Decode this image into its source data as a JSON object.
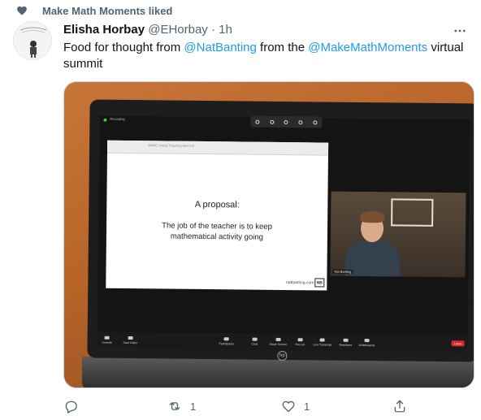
{
  "social_context": {
    "text": "Make Math Moments liked"
  },
  "tweet": {
    "display_name": "Elisha Horbay",
    "handle": "@EHorbay",
    "separator": "·",
    "time": "1h",
    "text_parts": {
      "p1": "Food for thought from ",
      "mention1": "@NatBanting",
      "p2": " from the ",
      "mention2": "@MakeMathMoments",
      "p3": " virtual summit"
    }
  },
  "media": {
    "recording_label": "Recording",
    "slide_titlebar": "SMME Virtual Teaching Moment",
    "slide_heading": "A proposal:",
    "slide_body": "The job of the teacher is to keep mathematical activity going",
    "slide_footer": "natbanting.com",
    "slide_logo": "NB",
    "participant_name": "Nat Banting",
    "controls": [
      "Unmute",
      "Start Video",
      "Participants",
      "Chat",
      "Share Screen",
      "Record",
      "Live Transcript",
      "Reactions",
      "Whiteboards"
    ],
    "leave_label": "Leave",
    "laptop_logo": "hp"
  },
  "actions": {
    "reply_count": "",
    "retweet_count": "1",
    "like_count": "1"
  },
  "icons": {
    "social": "heart-icon",
    "more": "more-icon",
    "reply": "reply-icon",
    "retweet": "retweet-icon",
    "like": "like-icon",
    "share": "share-icon"
  },
  "colors": {
    "link": "#1d9bf0",
    "secondary_text": "#536471",
    "primary_text": "#0f1419"
  }
}
